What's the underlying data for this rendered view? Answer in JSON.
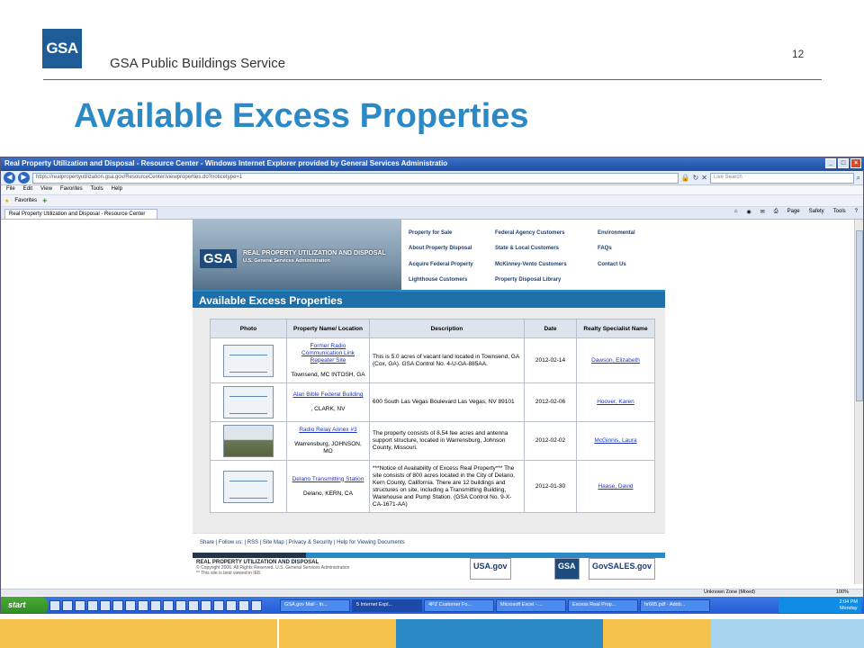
{
  "slide": {
    "logo": "GSA",
    "subtitle": "GSA Public Buildings Service",
    "page_number": "12",
    "title": "Available Excess Properties"
  },
  "browser": {
    "window_title": "Real Property Utilization and Disposal - Resource Center - Windows Internet Explorer provided by General Services Administratio",
    "address": "https://realpropertyutilization.gsa.gov/ResourceCenter/viewproperties.do?noticetype=1",
    "search_placeholder": "Live Search",
    "menu": [
      "File",
      "Edit",
      "View",
      "Favorites",
      "Tools",
      "Help"
    ],
    "favorites_label": "Favorites",
    "tab_label": "Real Property Utilization and Disposal - Resource Center",
    "commands": [
      "Page",
      "Safety",
      "Tools"
    ]
  },
  "site": {
    "banner_logo": "GSA",
    "banner_title": "REAL PROPERTY UTILIZATION AND DISPOSAL",
    "banner_subtitle": "U.S. General Services Administration",
    "nav": [
      "Property for Sale",
      "Federal Agency Customers",
      "Environmental",
      "About Property Disposal",
      "State & Local Customers",
      "FAQs",
      "Acquire Federal Property",
      "McKinney-Vento Customers",
      "Contact Us",
      "Lighthouse Customers",
      "Property Disposal Library",
      ""
    ],
    "section_heading": "Available Excess Properties",
    "table": {
      "headers": [
        "Photo",
        "Property Name/ Location",
        "Description",
        "Date",
        "Realty Specialist Name"
      ],
      "rows": [
        {
          "name": "Former Radio Communication Link Repeater Site",
          "location": "Townsend, MC INTOSH, GA",
          "description": "This is 5.0 acres of vacant land located in Townsend, GA (Cox, GA). GSA Control No. 4-U-GA-885AA.",
          "date": "2012-02-14",
          "specialist": "Dawson, Elizabeth",
          "photo": "placeholder"
        },
        {
          "name": "Alan Bible Federal Building",
          "location": ", CLARK, NV",
          "description": "600 South Las Vegas Boulevard Las Vegas, NV 89101",
          "date": "2012-02-06",
          "specialist": "Hoover, Karen",
          "photo": "placeholder"
        },
        {
          "name": "Radio Relay Annex #3",
          "location": "Warrensburg, JOHNSON, MO",
          "description": "The property consists of 8.54 fee acres and antenna support structure, located in Warrensburg, Johnson County, Missouri.",
          "date": "2012-02-02",
          "specialist": "McGinnis, Laura",
          "photo": "field"
        },
        {
          "name": "Delano Transmitting Station",
          "location": "Delano, KERN, CA",
          "description": "***Notice of Availability of Excess Real Property*** The site consists of 800 acres located in the City of Delano, Kern County, California. There are 12 buildings and structures on site, including a Transmitting Building, Warehouse and Pump Station. (GSA Control No. 9-X-CA-1671-AA)",
          "date": "2012-01-30",
          "specialist": "Haase, David",
          "photo": "placeholder"
        }
      ]
    },
    "footer_links": "Share  |  Follow us:  |  RSS  |  Site Map  |  Privacy & Security  |  Help for Viewing Documents",
    "footer_title": "REAL PROPERTY UTILIZATION AND DISPOSAL",
    "footer_copyright": "© Copyright 2006. All Rights Reserved. U.S. General Services Administration",
    "footer_note": "** This site is best viewed in IE8.",
    "footer_logos": [
      "USA.gov",
      "GSA",
      "GovSALES.gov"
    ]
  },
  "statusbar": {
    "zone": "Unknown Zone (Mixed)",
    "zoom": "100%"
  },
  "taskbar": {
    "start": "start",
    "tasks": [
      "GSA.gov Mail - In...",
      "5 Internet Expl...",
      "4PZ Customer Fo...",
      "Microsoft Excel - ...",
      "Excess Real Prop...",
      "hr665.pdf - Adob..."
    ],
    "time": "2:04 PM",
    "day": "Monday"
  },
  "colors": {
    "title_blue": "#2b8ac6",
    "gsa_blue": "#1d5c96",
    "deco_gold": "#f5c24b",
    "deco_blue": "#2b8ac6"
  }
}
